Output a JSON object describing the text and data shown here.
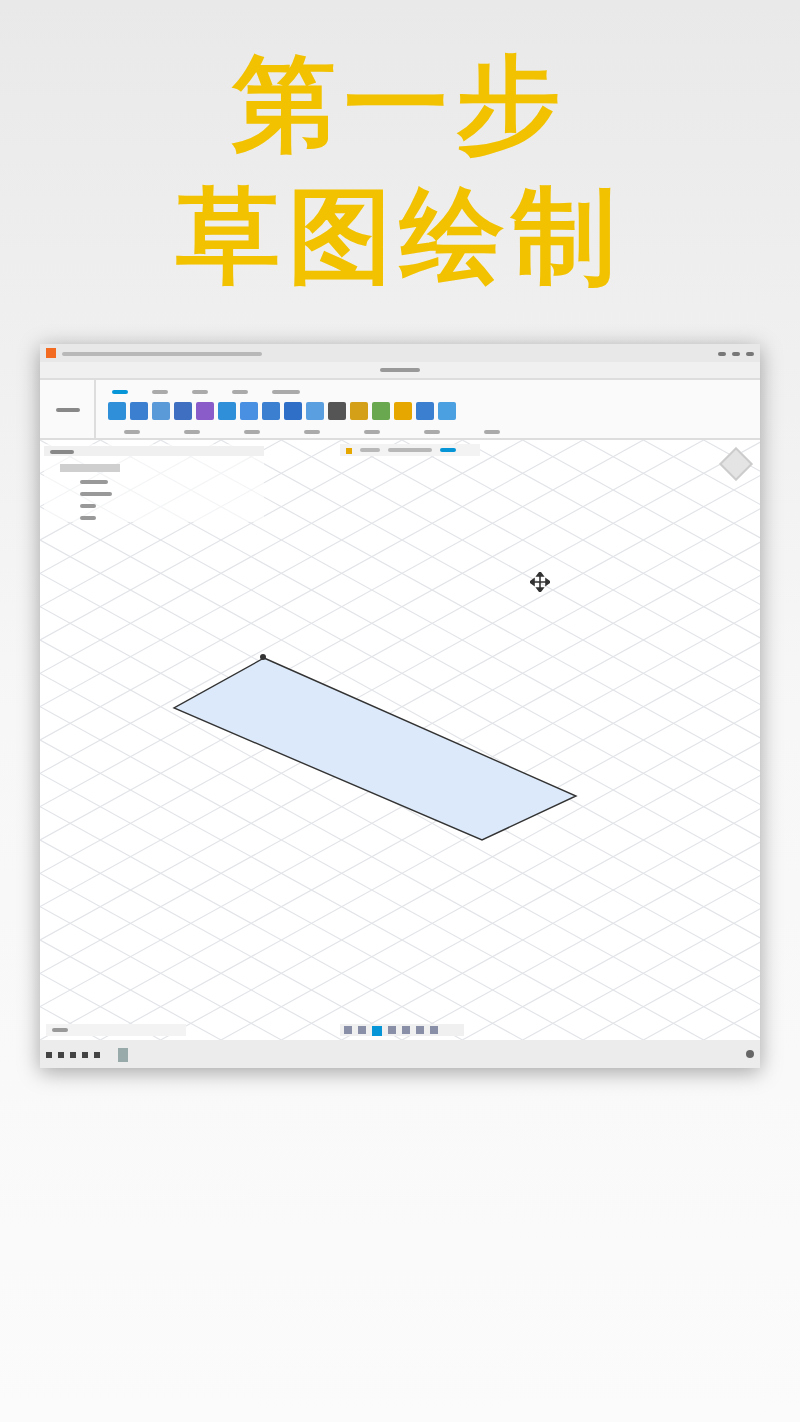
{
  "headline": [
    "第一步",
    "草图绘制"
  ],
  "rectangle": {
    "selected": true
  }
}
